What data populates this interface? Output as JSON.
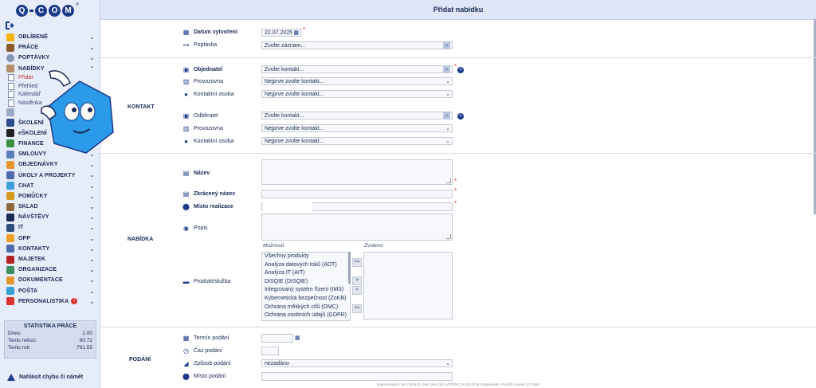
{
  "header": {
    "title": "Přidat nabídku"
  },
  "logo": {
    "letters": [
      "Q",
      "C",
      "O",
      "M"
    ],
    "registered": "®"
  },
  "sidebar": {
    "menu": [
      {
        "label": "OBLÍBENÉ",
        "color": "#f5b400"
      },
      {
        "label": "PRÁCE",
        "color": "#8a5a2b"
      },
      {
        "label": "POPTÁVKY",
        "color": "#1b3a8c"
      },
      {
        "label": "NABÍDKY",
        "color": "#b58f6a"
      }
    ],
    "submenu": [
      {
        "label": "Přidat"
      },
      {
        "label": "Přehled"
      },
      {
        "label": "Kalendář"
      },
      {
        "label": "Nástěnka"
      }
    ],
    "menu2": [
      {
        "label": "",
        "color": "#9aa8c5"
      },
      {
        "label": "ŠKOLENÍ",
        "color": "#2d4d8f"
      },
      {
        "label": "eŠKOLENÍ",
        "color": "#222"
      },
      {
        "label": "FINANCE",
        "color": "#3c8f3c"
      },
      {
        "label": "SMLOUVY",
        "color": "#5d7fbf"
      },
      {
        "label": "OBJEDNÁVKY",
        "color": "#e7962c"
      },
      {
        "label": "ÚKOLY A PROJEKTY",
        "color": "#4f6bab"
      },
      {
        "label": "CHAT",
        "color": "#3aa0d8"
      },
      {
        "label": "POMŮCKY",
        "color": "#d69a1e"
      },
      {
        "label": "SKLAD",
        "color": "#8a6a3b"
      },
      {
        "label": "NÁVŠTĚVY",
        "color": "#1b2a55"
      },
      {
        "label": "IT",
        "color": "#2f4f7f"
      },
      {
        "label": "OPP",
        "color": "#f0a020"
      },
      {
        "label": "KONTAKTY",
        "color": "#4f6bab"
      },
      {
        "label": "MAJETEK",
        "color": "#b22222"
      },
      {
        "label": "ORGANIZACE",
        "color": "#3b8f5c"
      },
      {
        "label": "DOKUMENTACE",
        "color": "#e7962c"
      },
      {
        "label": "POŠTA",
        "color": "#3aa0d8"
      },
      {
        "label": "PERSONALISTIKA",
        "color": "#d9332f",
        "badge": "!"
      }
    ],
    "stats": {
      "title": "STATISTIKA PRÁCE",
      "rows": [
        {
          "label": "Dnes:",
          "value": "2.00"
        },
        {
          "label": "Tento měsíc:",
          "value": "80.72"
        },
        {
          "label": "Tento rok:",
          "value": "791.55"
        }
      ]
    },
    "report_label": "Nahlásit chybu či námět"
  },
  "form": {
    "top": {
      "date_label": "Datum vytvoření",
      "date_value": "22.07.2025",
      "request_label": "Poptávka",
      "request_value": "Zvolte záznam..."
    },
    "contact": {
      "section_title": "KONTAKT",
      "client_label": "Objednatel",
      "client_value": "Zvolte kontakt...",
      "branch1_label": "Provozovna",
      "branch1_value": "Nejprve zvolte kontakt...",
      "person1_label": "Kontaktní osoba",
      "person1_value": "Nejprve zvolte kontakt...",
      "receiver_label": "Odběratel",
      "receiver_value": "Zvolte kontakt...",
      "branch2_label": "Provozovna",
      "branch2_value": "Nejprve zvolte kontakt...",
      "person2_label": "Kontaktní osoba",
      "person2_value": "Nejprve zvolte kontakt..."
    },
    "offer": {
      "section_title": "NABÍDKA",
      "name_label": "Název",
      "short_label": "Zkrácený název",
      "place_label": "Místo realizace",
      "desc_label": "Popis",
      "product_label": "Produkt/služba",
      "options_caption": "Možnosti:",
      "chosen_caption": "Zvoleno:",
      "options": [
        "Všechny produkty",
        "Analýza datových toků (ADT)",
        "Analýza IT (AIT)",
        "DISQIE (DISQIE)",
        "Integrovaný systém řízení (IMS)",
        "Kybernetická bezpečnost (ZoKB)",
        "Ochrana měkkých cílů (OMC)",
        "Ochrana osobních údajů (GDPR)"
      ],
      "buttons": [
        ">>",
        ">",
        "<",
        "<<"
      ]
    },
    "submit": {
      "section_title": "PODÁNÍ",
      "deadline_label": "Termín podání",
      "time_label": "Čas podání",
      "method_label": "Způsob podání",
      "method_value": "nezadáno",
      "place_label": "Místo podání"
    }
  },
  "footer": "Vygenerováno za 0.254s (0.196s, 5ks, 0x) | v27026 | 26.03.2025 | Nápověda | Použití cookies | © QML"
}
